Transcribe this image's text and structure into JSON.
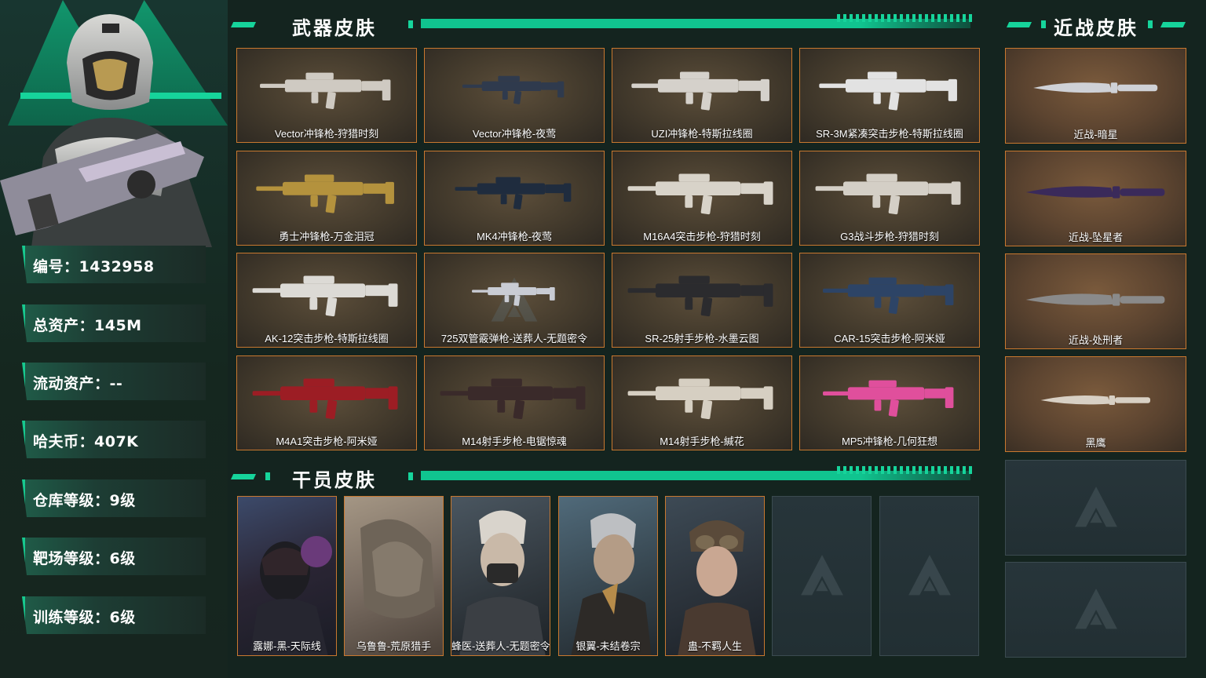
{
  "colors": {
    "accent": "#16d49b",
    "card_border": "#c9782f",
    "background": "#14241f"
  },
  "player": {
    "stats": [
      {
        "text": "编号：1432958"
      },
      {
        "text": "总资产：145M"
      },
      {
        "text": "流动资产：--"
      },
      {
        "text": "哈夫币：407K"
      },
      {
        "text": "仓库等级：9级"
      },
      {
        "text": "靶场等级：6级"
      },
      {
        "text": "训练等级：6级"
      }
    ]
  },
  "sections": {
    "weapons_title": "武器皮肤",
    "melee_title": "近战皮肤",
    "agents_title": "干员皮肤"
  },
  "weapons": [
    {
      "label": "Vector冲锋枪-狩猎时刻",
      "icon": "smg-vector-white"
    },
    {
      "label": "Vector冲锋枪-夜莺",
      "icon": "smg-vector-blue"
    },
    {
      "label": "UZI冲锋枪-特斯拉线圈",
      "icon": "smg-uzi-white"
    },
    {
      "label": "SR-3M紧凑突击步枪-特斯拉线圈",
      "icon": "rifle-sr3m-white"
    },
    {
      "label": "勇士冲锋枪-万金泪冠",
      "icon": "smg-gold"
    },
    {
      "label": "MK4冲锋枪-夜莺",
      "icon": "smg-mk4-blue"
    },
    {
      "label": "M16A4突击步枪-狩猎时刻",
      "icon": "rifle-m16-white"
    },
    {
      "label": "G3战斗步枪-狩猎时刻",
      "icon": "rifle-g3-white"
    },
    {
      "label": "AK-12突击步枪-特斯拉线圈",
      "icon": "rifle-ak12-white"
    },
    {
      "label": "725双管霰弹枪-送葬人-无题密令",
      "icon": "shotgun-725"
    },
    {
      "label": "SR-25射手步枪-水墨云图",
      "icon": "rifle-sr25-ink"
    },
    {
      "label": "CAR-15突击步枪-阿米娅",
      "icon": "rifle-car15-blue"
    },
    {
      "label": "M4A1突击步枪-阿米娅",
      "icon": "rifle-m4a1-red"
    },
    {
      "label": "M14射手步枪-电锯惊魂",
      "icon": "rifle-m14-red"
    },
    {
      "label": "M14射手步枪-緘花",
      "icon": "rifle-m14-gold"
    },
    {
      "label": "MP5冲锋枪-几何狂想",
      "icon": "smg-mp5-pink"
    }
  ],
  "melee": [
    {
      "label": "近战-暗星",
      "icon": "knife-dark-star"
    },
    {
      "label": "近战-坠星者",
      "icon": "knife-purple"
    },
    {
      "label": "近战-处刑者",
      "icon": "knife-executioner"
    },
    {
      "label": "黑鹰",
      "icon": "knife-blackhawk"
    }
  ],
  "agents": [
    {
      "label": "露娜-黑-天际线",
      "icon": "agent-luna"
    },
    {
      "label": "乌鲁鲁-荒原猎手",
      "icon": "agent-uluru"
    },
    {
      "label": "蜂医-送葬人-无题密令",
      "icon": "agent-medic"
    },
    {
      "label": "银翼-未结卷宗",
      "icon": "agent-silverwing"
    },
    {
      "label": "蛊-不羁人生",
      "icon": "agent-gu"
    }
  ]
}
